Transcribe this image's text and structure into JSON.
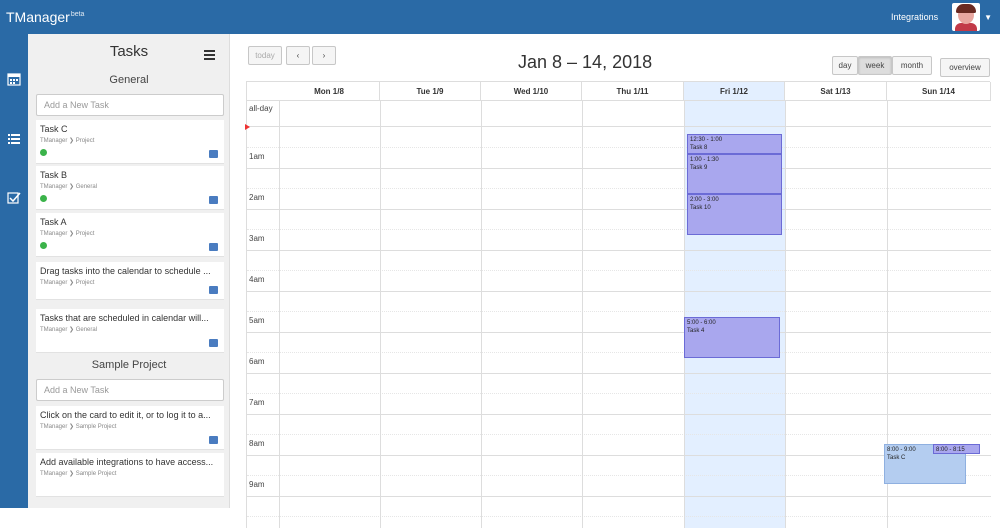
{
  "app": {
    "brand": "TManager",
    "brand_sup": "beta",
    "integrations": "Integrations"
  },
  "panel": {
    "title": "Tasks",
    "general": {
      "title": "General",
      "placeholder": "Add a New Task",
      "tasks": [
        {
          "title": "Task C",
          "project": "TManager ❯ Project"
        },
        {
          "title": "Task B",
          "project": "TManager ❯ General"
        },
        {
          "title": "Task A",
          "project": "TManager ❯ Project"
        },
        {
          "title": "Drag tasks into the calendar to schedule ...",
          "project": "TManager ❯ Project"
        },
        {
          "title": "Tasks that are scheduled in calendar will...",
          "project": "TManager ❯ General"
        }
      ]
    },
    "sample": {
      "title": "Sample Project",
      "placeholder": "Add a New Task",
      "tasks": [
        {
          "title": "Click on the card to edit it, or to log it to a...",
          "project": "TManager ❯ Sample Project"
        },
        {
          "title": "Add available integrations to have access...",
          "project": "TManager ❯ Sample Project"
        }
      ]
    }
  },
  "calendar": {
    "today_label": "today",
    "prev": "‹",
    "next": "›",
    "title": "Jan 8 – 14, 2018",
    "views": {
      "day": "day",
      "week": "week",
      "month": "month"
    },
    "overview": "overview",
    "allday": "all-day",
    "days": [
      "Mon 1/8",
      "Tue 1/9",
      "Wed 1/10",
      "Thu 1/11",
      "Fri 1/12",
      "Sat 1/13",
      "Sun 1/14"
    ],
    "hours": [
      "1am",
      "2am",
      "3am",
      "4am",
      "5am",
      "6am",
      "7am",
      "8am",
      "9am"
    ],
    "events": [
      {
        "time": "12:30 - 1:00",
        "title": "Task 8"
      },
      {
        "time": "1:00 - 1:30",
        "title": "Task 9"
      },
      {
        "time": "2:00 - 3:00",
        "title": "Task 10"
      },
      {
        "time": "5:00 - 6:00",
        "title": "Task 4"
      },
      {
        "time": "8:00 - 9:00",
        "title": "Task C"
      },
      {
        "time": "8:00 - 8:15",
        "title": ""
      }
    ]
  }
}
